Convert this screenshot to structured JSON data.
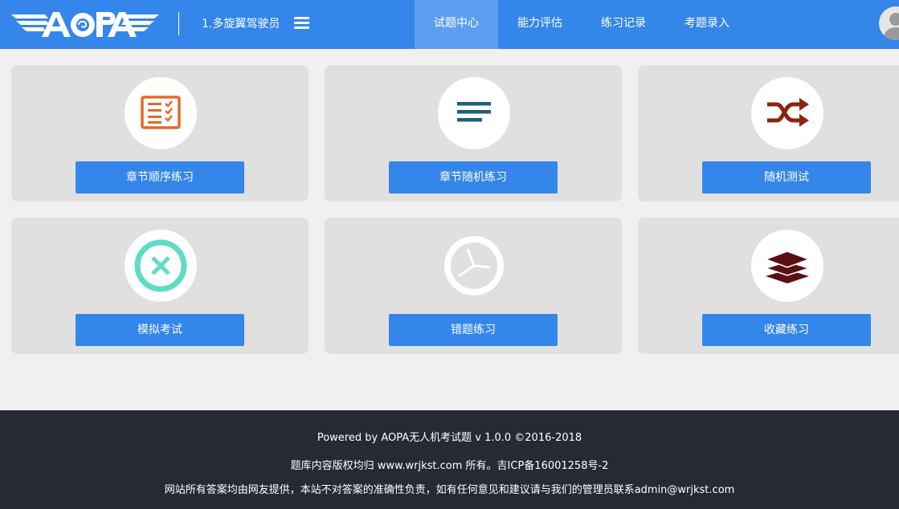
{
  "header": {
    "logo_text": "AOPA",
    "subject": "1.多旋翼驾驶员",
    "nav": [
      {
        "label": "试题中心",
        "active": true
      },
      {
        "label": "能力评估",
        "active": false
      },
      {
        "label": "练习记录",
        "active": false
      },
      {
        "label": "考题录入",
        "active": false
      }
    ]
  },
  "cards": [
    {
      "label": "章节顺序练习",
      "icon": "checklist-icon",
      "icon_color": "#e8672b"
    },
    {
      "label": "章节随机练习",
      "icon": "lines-icon",
      "icon_color": "#1f5f7a"
    },
    {
      "label": "随机测试",
      "icon": "shuffle-icon",
      "icon_color": "#8c2414"
    },
    {
      "label": "模拟考试",
      "icon": "close-circle-icon",
      "icon_color": "#5fdcc4"
    },
    {
      "label": "错题练习",
      "icon": "clock-icon",
      "icon_color": "#ffffff"
    },
    {
      "label": "收藏练习",
      "icon": "layers-icon",
      "icon_color": "#5a0f12"
    }
  ],
  "footer": {
    "line1": "Powered by AOPA无人机考试题 v 1.0.0 ©2016-2018",
    "line2": "题库内容版权均归 www.wrjkst.com 所有。吉ICP备16001258号-2",
    "line3": "网站所有答案均由网友提供，本站不对答案的准确性负责，如有任何意见和建议请与我们的管理员联系admin@wrjkst.com"
  },
  "colors": {
    "header_bg": "#3486ea",
    "button_bg": "#3486ea",
    "card_bg": "#e0e0e0",
    "footer_bg": "#262a33",
    "page_bg": "#f0f0f0"
  }
}
